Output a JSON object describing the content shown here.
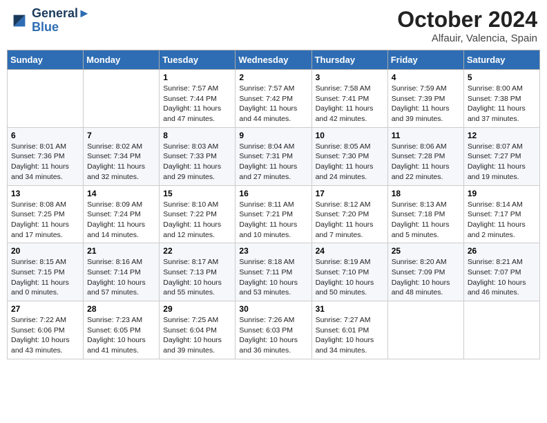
{
  "logo": {
    "line1": "General",
    "line2": "Blue"
  },
  "title": "October 2024",
  "location": "Alfauir, Valencia, Spain",
  "days_of_week": [
    "Sunday",
    "Monday",
    "Tuesday",
    "Wednesday",
    "Thursday",
    "Friday",
    "Saturday"
  ],
  "weeks": [
    [
      {
        "day": "",
        "info": ""
      },
      {
        "day": "",
        "info": ""
      },
      {
        "day": "1",
        "info": "Sunrise: 7:57 AM\nSunset: 7:44 PM\nDaylight: 11 hours and 47 minutes."
      },
      {
        "day": "2",
        "info": "Sunrise: 7:57 AM\nSunset: 7:42 PM\nDaylight: 11 hours and 44 minutes."
      },
      {
        "day": "3",
        "info": "Sunrise: 7:58 AM\nSunset: 7:41 PM\nDaylight: 11 hours and 42 minutes."
      },
      {
        "day": "4",
        "info": "Sunrise: 7:59 AM\nSunset: 7:39 PM\nDaylight: 11 hours and 39 minutes."
      },
      {
        "day": "5",
        "info": "Sunrise: 8:00 AM\nSunset: 7:38 PM\nDaylight: 11 hours and 37 minutes."
      }
    ],
    [
      {
        "day": "6",
        "info": "Sunrise: 8:01 AM\nSunset: 7:36 PM\nDaylight: 11 hours and 34 minutes."
      },
      {
        "day": "7",
        "info": "Sunrise: 8:02 AM\nSunset: 7:34 PM\nDaylight: 11 hours and 32 minutes."
      },
      {
        "day": "8",
        "info": "Sunrise: 8:03 AM\nSunset: 7:33 PM\nDaylight: 11 hours and 29 minutes."
      },
      {
        "day": "9",
        "info": "Sunrise: 8:04 AM\nSunset: 7:31 PM\nDaylight: 11 hours and 27 minutes."
      },
      {
        "day": "10",
        "info": "Sunrise: 8:05 AM\nSunset: 7:30 PM\nDaylight: 11 hours and 24 minutes."
      },
      {
        "day": "11",
        "info": "Sunrise: 8:06 AM\nSunset: 7:28 PM\nDaylight: 11 hours and 22 minutes."
      },
      {
        "day": "12",
        "info": "Sunrise: 8:07 AM\nSunset: 7:27 PM\nDaylight: 11 hours and 19 minutes."
      }
    ],
    [
      {
        "day": "13",
        "info": "Sunrise: 8:08 AM\nSunset: 7:25 PM\nDaylight: 11 hours and 17 minutes."
      },
      {
        "day": "14",
        "info": "Sunrise: 8:09 AM\nSunset: 7:24 PM\nDaylight: 11 hours and 14 minutes."
      },
      {
        "day": "15",
        "info": "Sunrise: 8:10 AM\nSunset: 7:22 PM\nDaylight: 11 hours and 12 minutes."
      },
      {
        "day": "16",
        "info": "Sunrise: 8:11 AM\nSunset: 7:21 PM\nDaylight: 11 hours and 10 minutes."
      },
      {
        "day": "17",
        "info": "Sunrise: 8:12 AM\nSunset: 7:20 PM\nDaylight: 11 hours and 7 minutes."
      },
      {
        "day": "18",
        "info": "Sunrise: 8:13 AM\nSunset: 7:18 PM\nDaylight: 11 hours and 5 minutes."
      },
      {
        "day": "19",
        "info": "Sunrise: 8:14 AM\nSunset: 7:17 PM\nDaylight: 11 hours and 2 minutes."
      }
    ],
    [
      {
        "day": "20",
        "info": "Sunrise: 8:15 AM\nSunset: 7:15 PM\nDaylight: 11 hours and 0 minutes."
      },
      {
        "day": "21",
        "info": "Sunrise: 8:16 AM\nSunset: 7:14 PM\nDaylight: 10 hours and 57 minutes."
      },
      {
        "day": "22",
        "info": "Sunrise: 8:17 AM\nSunset: 7:13 PM\nDaylight: 10 hours and 55 minutes."
      },
      {
        "day": "23",
        "info": "Sunrise: 8:18 AM\nSunset: 7:11 PM\nDaylight: 10 hours and 53 minutes."
      },
      {
        "day": "24",
        "info": "Sunrise: 8:19 AM\nSunset: 7:10 PM\nDaylight: 10 hours and 50 minutes."
      },
      {
        "day": "25",
        "info": "Sunrise: 8:20 AM\nSunset: 7:09 PM\nDaylight: 10 hours and 48 minutes."
      },
      {
        "day": "26",
        "info": "Sunrise: 8:21 AM\nSunset: 7:07 PM\nDaylight: 10 hours and 46 minutes."
      }
    ],
    [
      {
        "day": "27",
        "info": "Sunrise: 7:22 AM\nSunset: 6:06 PM\nDaylight: 10 hours and 43 minutes."
      },
      {
        "day": "28",
        "info": "Sunrise: 7:23 AM\nSunset: 6:05 PM\nDaylight: 10 hours and 41 minutes."
      },
      {
        "day": "29",
        "info": "Sunrise: 7:25 AM\nSunset: 6:04 PM\nDaylight: 10 hours and 39 minutes."
      },
      {
        "day": "30",
        "info": "Sunrise: 7:26 AM\nSunset: 6:03 PM\nDaylight: 10 hours and 36 minutes."
      },
      {
        "day": "31",
        "info": "Sunrise: 7:27 AM\nSunset: 6:01 PM\nDaylight: 10 hours and 34 minutes."
      },
      {
        "day": "",
        "info": ""
      },
      {
        "day": "",
        "info": ""
      }
    ]
  ]
}
